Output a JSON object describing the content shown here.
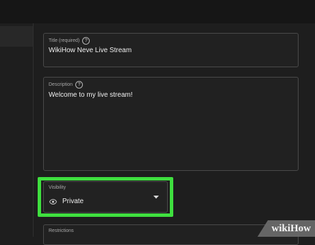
{
  "form": {
    "title_label": "Title (required)",
    "title_value": "WikiHow Neve Live Stream",
    "description_label": "Description",
    "description_value": "Welcome to my live stream!",
    "visibility_label": "Visibility",
    "visibility_value": "Private",
    "restrictions_label": "Restrictions"
  },
  "icons": {
    "help": "question-circle-icon",
    "visibility": "eye-icon",
    "dropdown": "caret-down-icon"
  },
  "colors": {
    "highlight": "#3fe03f",
    "background": "#1e1e1e"
  },
  "watermark": {
    "prefix": "wiki",
    "suffix": "How"
  }
}
